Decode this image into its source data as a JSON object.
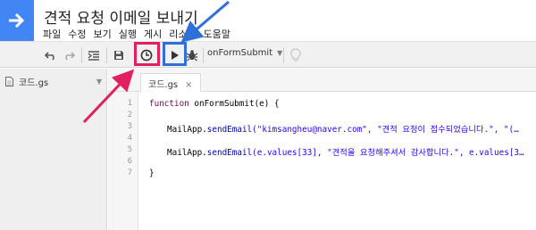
{
  "app": {
    "title": "견적 요청 이메일 보내기"
  },
  "menu": [
    {
      "label": "파일"
    },
    {
      "label": "수정"
    },
    {
      "label": "보기"
    },
    {
      "label": "실행"
    },
    {
      "label": "게시"
    },
    {
      "label": "리소스"
    },
    {
      "label": "도움말"
    }
  ],
  "toolbar": {
    "function_name": "onFormSubmit"
  },
  "sidebar": {
    "file_label": "코드.gs"
  },
  "editor": {
    "tab_label": "코드.gs",
    "line_numbers": [
      "1",
      "2",
      "3",
      "4",
      "5",
      "6",
      "7"
    ],
    "code": {
      "l1_kw": "function",
      "l1_name": "onFormSubmit",
      "l1_rest": "(e) {",
      "l3_a": "MailApp.",
      "l3_fn": "sendEmail",
      "l3_b": "(\"kimsangheu@naver.com\", \"견적 요청이 접수되었습니다.\", \"(…",
      "l5_a": "MailApp.",
      "l5_fn": "sendEmail",
      "l5_b": "(e.values[33], \"견적을 요청해주셔서 감사합니다.\", e.values[3…",
      "l7": "}"
    }
  },
  "colors": {
    "highlight_red": "#e0205f",
    "highlight_blue": "#2f6fd8"
  }
}
